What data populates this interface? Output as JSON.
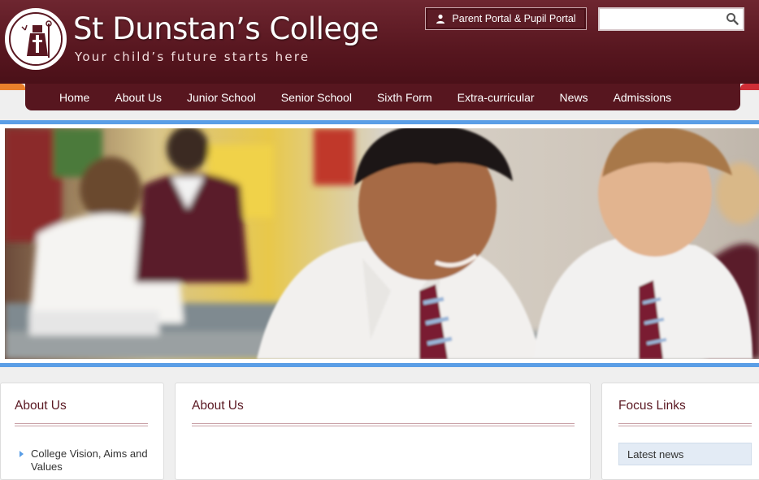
{
  "header": {
    "site_title": "St Dunstan’s College",
    "tagline": "Your child’s future starts here",
    "portal_label": "Parent Portal & Pupil Portal",
    "search_placeholder": ""
  },
  "nav": {
    "items": [
      "Home",
      "About Us",
      "Junior School",
      "Senior School",
      "Sixth Form",
      "Extra-curricular",
      "News",
      "Admissions"
    ]
  },
  "left_column": {
    "heading": "About Us",
    "links": [
      "College Vision, Aims and Values"
    ]
  },
  "main_column": {
    "heading": "About Us"
  },
  "right_column": {
    "heading": "Focus Links",
    "links": [
      "Latest news"
    ]
  },
  "colors": {
    "brand_maroon": "#57161f",
    "accent_blue": "#5a9ee6",
    "accent_orange": "#e97f2b",
    "accent_red": "#cf2e36"
  }
}
